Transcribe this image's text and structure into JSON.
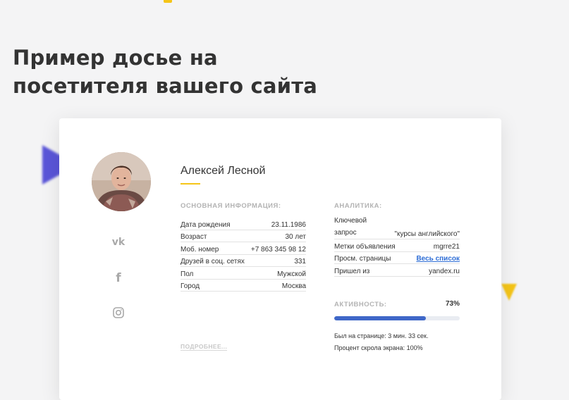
{
  "headline": {
    "line1": "Пример досье на",
    "line2": "посетителя вашего сайта"
  },
  "profile": {
    "name": "Алексей Лесной",
    "social_icons": [
      "vk-icon",
      "facebook-icon",
      "instagram-icon"
    ]
  },
  "basic_info": {
    "title": "ОСНОВНАЯ ИНФОРМАЦИЯ:",
    "rows": [
      {
        "label": "Дата рождения",
        "value": "23.11.1986"
      },
      {
        "label": "Возраст",
        "value": "30 лет"
      },
      {
        "label": "Моб. номер",
        "value": "+7 863 345 98 12"
      },
      {
        "label": "Друзей в соц. сетях",
        "value": "331"
      },
      {
        "label": "Пол",
        "value": "Мужской"
      },
      {
        "label": "Город",
        "value": "Москва"
      }
    ],
    "more_link": "ПОДРОБНЕЕ..."
  },
  "analytics": {
    "title": "АНАЛИТИКА:",
    "keyword_label_1": "Ключевой",
    "keyword_label_2": "запрос",
    "keyword_value": "\"курсы английского\"",
    "rows": [
      {
        "label": "Метки объявления",
        "value": "mgrre21"
      },
      {
        "label": "Просм. страницы",
        "value": "Весь список"
      },
      {
        "label": "Пришел из",
        "value": "yandex.ru"
      }
    ]
  },
  "activity": {
    "label": "АКТИВНОСТЬ:",
    "percent_text": "73%",
    "percent": 73,
    "time_on_page": "Был на странице: 3 мин. 33 сек.",
    "scroll_percent": "Процент скрола экрана: 100%"
  },
  "colors": {
    "accent_yellow": "#f5c518",
    "arrow_purple": "#5a55d8",
    "progress_blue": "#3f67c8",
    "link_blue": "#2f6ed6"
  }
}
